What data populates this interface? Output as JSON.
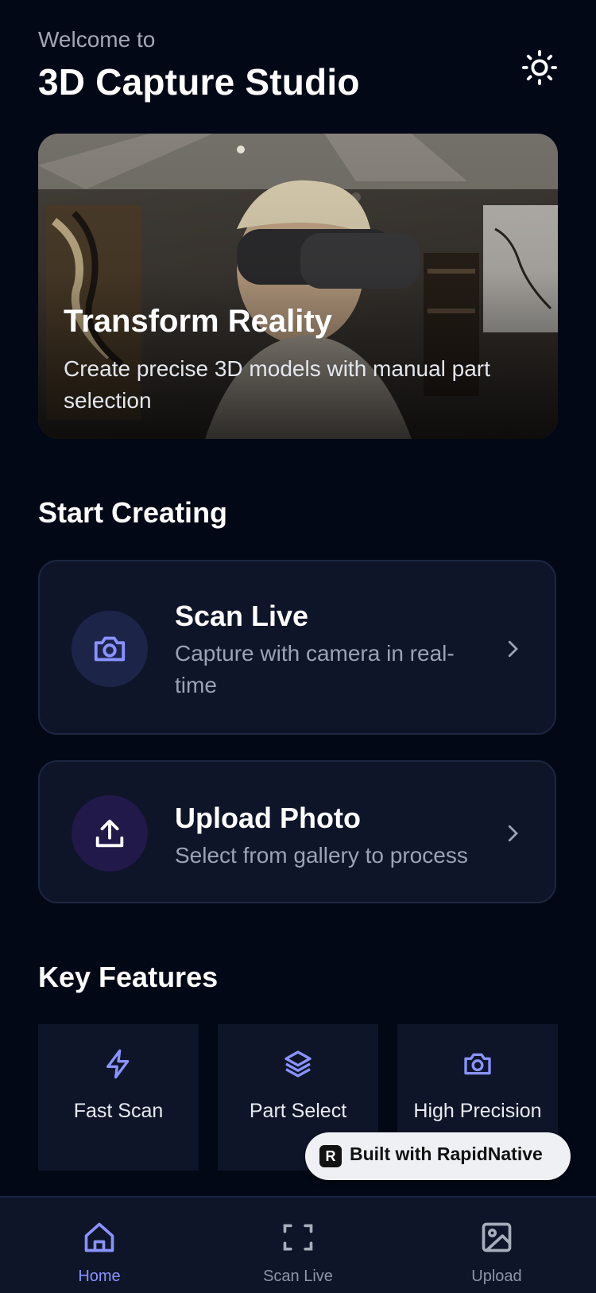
{
  "header": {
    "welcome": "Welcome to",
    "title": "3D Capture Studio",
    "theme_icon": "sun-icon"
  },
  "hero": {
    "title": "Transform Reality",
    "subtitle": "Create precise 3D models with manual part selection"
  },
  "start_section": {
    "title": "Start Creating",
    "actions": [
      {
        "title": "Scan Live",
        "description": "Capture with camera in real-time",
        "icon": "camera-icon"
      },
      {
        "title": "Upload Photo",
        "description": "Select from gallery to process",
        "icon": "upload-icon"
      }
    ]
  },
  "features_section": {
    "title": "Key Features",
    "items": [
      {
        "label": "Fast Scan",
        "icon": "lightning-icon"
      },
      {
        "label": "Part Select",
        "icon": "layers-icon"
      },
      {
        "label": "High Precision",
        "icon": "camera-icon"
      }
    ]
  },
  "badge": {
    "label": "Built with RapidNative",
    "logo_text": "R"
  },
  "tabbar": {
    "tabs": [
      {
        "label": "Home",
        "icon": "home-icon",
        "active": true
      },
      {
        "label": "Scan Live",
        "icon": "scan-icon",
        "active": false
      },
      {
        "label": "Upload",
        "icon": "image-icon",
        "active": false
      }
    ]
  },
  "colors": {
    "background": "#030816",
    "card": "#0e1528",
    "accent": "#8a92ff",
    "muted_text": "#9aa3b5"
  }
}
